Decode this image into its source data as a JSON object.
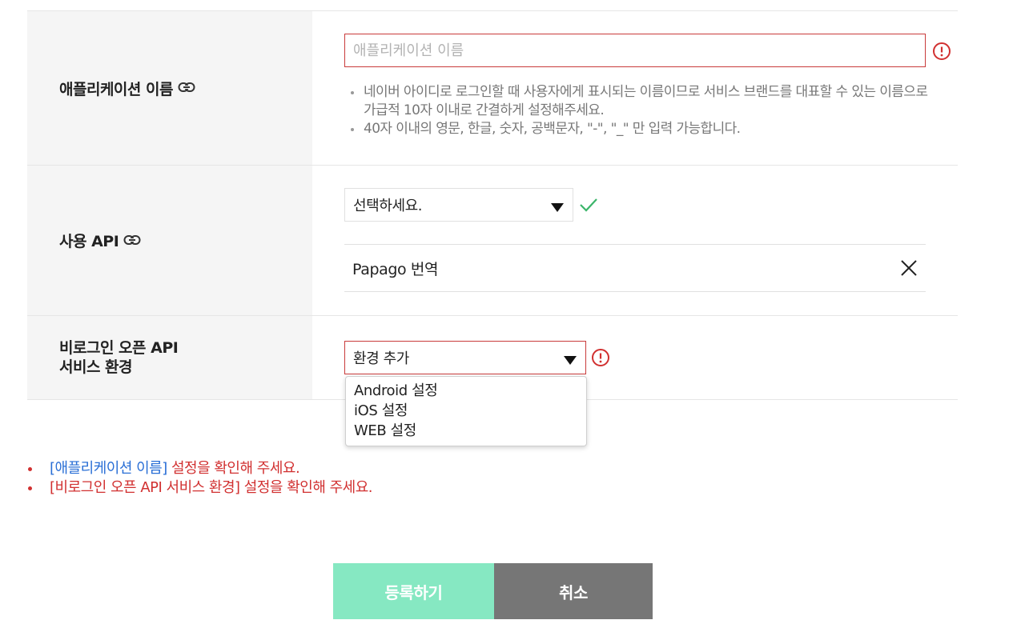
{
  "form": {
    "app_name": {
      "label": "애플리케이션 이름",
      "placeholder": "애플리케이션 이름",
      "value": "",
      "help": [
        "네이버 아이디로 로그인할 때 사용자에게 표시되는 이름이므로 서비스 브랜드를 대표할 수 있는 이름으로 가급적 10자 이내로 간결하게 설정해주세요.",
        "40자 이내의 영문, 한글, 숫자, 공백문자, \"-\", \"_\" 만 입력 가능합니다."
      ]
    },
    "api": {
      "label": "사용 API",
      "select_value": "선택하세요.",
      "selected_items": [
        "Papago 번역"
      ]
    },
    "env": {
      "label_line1": "비로그인 오픈 API",
      "label_line2": "서비스 환경",
      "select_value": "환경 추가",
      "options": [
        "Android 설정",
        "iOS 설정",
        "WEB 설정"
      ]
    }
  },
  "errors": [
    {
      "field": "[애플리케이션 이름]",
      "message": " 설정을 확인해 주세요.",
      "field_color": "#2a6fd6"
    },
    {
      "field": "[비로그인 오픈 API 서비스 환경]",
      "message": " 설정을 확인해 주세요.",
      "field_color": "#d13030"
    }
  ],
  "buttons": {
    "submit": "등록하기",
    "cancel": "취소"
  },
  "colors": {
    "error": "#d13030",
    "ok": "#3bb56a",
    "submit_bg": "#86e8c2",
    "cancel_bg": "#767676"
  },
  "icons": {
    "link": "link-icon",
    "error": "error-icon",
    "check": "check-icon",
    "close": "close-icon",
    "caret": "caret-down-icon"
  }
}
